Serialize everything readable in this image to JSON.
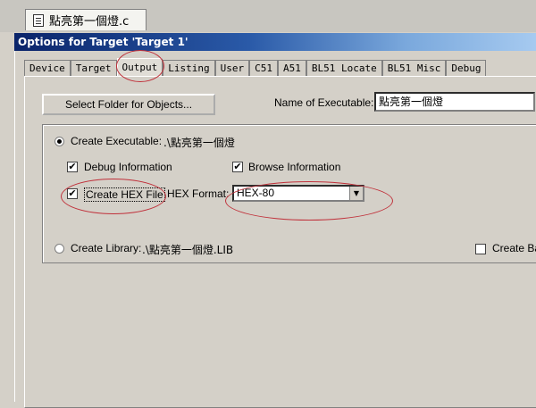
{
  "file_tab": {
    "label": "點亮第一個燈.c",
    "icon": "file-icon"
  },
  "window": {
    "title": "Options for Target 'Target 1'"
  },
  "tabs": [
    {
      "label": "Device"
    },
    {
      "label": "Target"
    },
    {
      "label": "Output",
      "active": true
    },
    {
      "label": "Listing"
    },
    {
      "label": "User"
    },
    {
      "label": "C51"
    },
    {
      "label": "A51"
    },
    {
      "label": "BL51 Locate"
    },
    {
      "label": "BL51 Misc"
    },
    {
      "label": "Debug"
    }
  ],
  "output": {
    "select_folder_label": "Select Folder for Objects...",
    "name_of_executable_label": "Name of Executable:",
    "name_of_executable_value": "點亮第一個燈",
    "create_executable": {
      "label": "Create Executable:",
      "path": ".\\點亮第一個燈",
      "selected": true
    },
    "debug_information": {
      "label": "Debug Information",
      "checked": true
    },
    "browse_information": {
      "label": "Browse Information",
      "checked": true
    },
    "create_hex_file": {
      "label": "Create HEX File",
      "checked": true
    },
    "hex_format": {
      "label": "HEX Format:",
      "value": "HEX-80"
    },
    "create_library": {
      "label": "Create Library:",
      "path": ".\\點亮第一個燈.LIB",
      "selected": false
    },
    "create_batch": {
      "label": "Create Ba",
      "checked": false
    }
  },
  "colors": {
    "annotation": "#c0303a",
    "titlebar": "#0a246a"
  }
}
